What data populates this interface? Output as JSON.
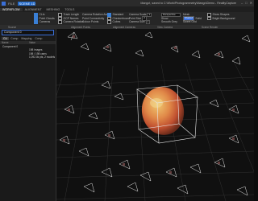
{
  "titlebar": {
    "tabs": [
      "FILE",
      "SCENE 1D"
    ],
    "active_tab": 1,
    "window_title": "Mango!, saved to C:\\Work\\Photogrammetry\\Mango\\Demo - RealityCapture",
    "controls": [
      "–",
      "□",
      "✕"
    ]
  },
  "ribbon_tabs": [
    "WORKFLOW",
    "ALIGNMENT",
    "MESHING",
    "TOOLS"
  ],
  "ribbon": {
    "col1": {
      "lines": [
        "CLIs",
        "Point Clouds",
        "Cameras"
      ]
    },
    "col2": {
      "lines": [
        "Track Length",
        "GCP Names",
        "Camera Rotation"
      ],
      "extra": [
        "Camera Rotation Axes",
        "Point Connectivity",
        "Colour Points"
      ]
    },
    "col3": {
      "lines": [
        "Standard",
        "Checkerboard",
        "Cubes"
      ]
    },
    "col4": {
      "lines": [
        "Camera Scale",
        "Point Size",
        "Camera Size"
      ],
      "values": [
        "1",
        "2",
        "1"
      ]
    },
    "col5": {
      "lines": [
        "Perspective",
        "Show",
        "Smooth Grey"
      ]
    },
    "col6": {
      "lines": [
        "Shaded",
        "Solid",
        "Sweet Grid"
      ],
      "labels": [
        "Mesh"
      ]
    },
    "col7": {
      "lines": [
        "Show Shapes",
        "Bright Background"
      ]
    }
  },
  "subheader": {
    "source": "Source",
    "panel": "Alignment Points",
    "cameras": "Alignment Cameras",
    "view": "View Camera",
    "scene": "Scene Render"
  },
  "left_panel": {
    "search_value": "Component 0",
    "tabs": [
      "CLI",
      "Comp",
      "Mapping",
      "Comp"
    ],
    "columns": [
      "Name",
      "Value"
    ],
    "rows": [
      {
        "name": "Component 0",
        "value": ""
      },
      {
        "name": "",
        "value": "198 images"
      },
      {
        "name": "",
        "value": "198 / 198 cams"
      },
      {
        "name": "",
        "value": "1,092.0k pts, 2 models"
      }
    ]
  }
}
